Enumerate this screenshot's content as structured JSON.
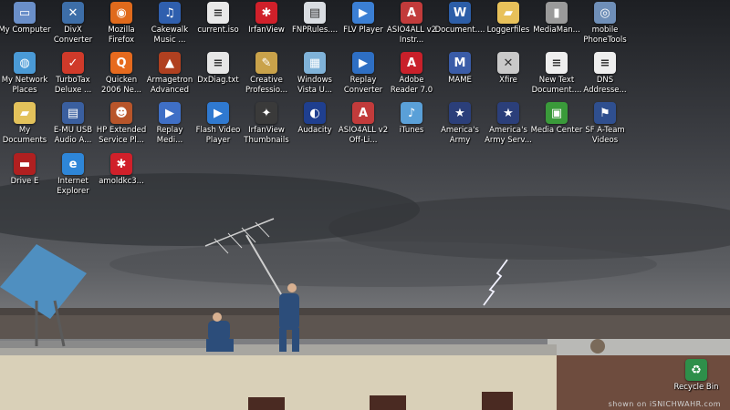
{
  "desktop": {
    "icons": [
      {
        "label": "My Computer",
        "glyph": "▭",
        "color": "#6a8fc9",
        "icon_name": "my-computer-icon"
      },
      {
        "label": "DivX Converter",
        "glyph": "✕",
        "color": "#3d6ea8",
        "icon_name": "divx-converter-icon"
      },
      {
        "label": "Mozilla Firefox",
        "glyph": "◉",
        "color": "#e06a1c",
        "icon_name": "firefox-icon"
      },
      {
        "label": "Cakewalk Music ...",
        "glyph": "♫",
        "color": "#2f5fae",
        "icon_name": "cakewalk-icon"
      },
      {
        "label": "current.iso",
        "glyph": "≡",
        "color": "#e8e8e8",
        "icon_name": "iso-file-icon"
      },
      {
        "label": "IrfanView",
        "glyph": "✱",
        "color": "#d0202a",
        "icon_name": "irfanview-icon"
      },
      {
        "label": "FNPRules....",
        "glyph": "▤",
        "color": "#d9dde2",
        "icon_name": "document-icon"
      },
      {
        "label": "FLV Player",
        "glyph": "▶",
        "color": "#3b7fd4",
        "icon_name": "flv-player-icon"
      },
      {
        "label": "ASIO4ALL v2 Instr...",
        "glyph": "A",
        "color": "#c23b3b",
        "icon_name": "asio4all-icon"
      },
      {
        "label": "Document....",
        "glyph": "W",
        "color": "#2c5ea8",
        "icon_name": "word-document-icon"
      },
      {
        "label": "Loggerfiles",
        "glyph": "▰",
        "color": "#e8c15a",
        "icon_name": "folder-icon"
      },
      {
        "label": "MediaMan...",
        "glyph": "▮",
        "color": "#9a9a9a",
        "icon_name": "media-manager-icon"
      },
      {
        "label": "mobile PhoneTools",
        "glyph": "◎",
        "color": "#6f8fb8",
        "icon_name": "phonetools-icon"
      },
      {
        "label": "My Network Places",
        "glyph": "◍",
        "color": "#4a9ad6",
        "icon_name": "network-places-icon"
      },
      {
        "label": "TurboTax Deluxe ...",
        "glyph": "✓",
        "color": "#d03a2a",
        "icon_name": "turbotax-icon"
      },
      {
        "label": "Quicken 2006 Ne...",
        "glyph": "Q",
        "color": "#e66a1e",
        "icon_name": "quicken-icon"
      },
      {
        "label": "Armagetron Advanced",
        "glyph": "▲",
        "color": "#b04020",
        "icon_name": "armagetron-icon"
      },
      {
        "label": "DxDiag.txt",
        "glyph": "≡",
        "color": "#e6e6e6",
        "icon_name": "text-file-icon"
      },
      {
        "label": "Creative Professio...",
        "glyph": "✎",
        "color": "#c9a24a",
        "icon_name": "creative-icon"
      },
      {
        "label": "Windows Vista U...",
        "glyph": "▦",
        "color": "#7fb2d8",
        "icon_name": "vista-upgrade-icon"
      },
      {
        "label": "Replay Converter",
        "glyph": "▶",
        "color": "#2e6fc4",
        "icon_name": "replay-converter-icon"
      },
      {
        "label": "Adobe Reader 7.0",
        "glyph": "A",
        "color": "#c9202a",
        "icon_name": "adobe-reader-icon"
      },
      {
        "label": "MAME",
        "glyph": "M",
        "color": "#3a5ca8",
        "icon_name": "mame-icon"
      },
      {
        "label": "Xfire",
        "glyph": "✕",
        "color": "#c9c9c9",
        "icon_name": "xfire-icon"
      },
      {
        "label": "New Text Document....",
        "glyph": "≡",
        "color": "#eeeeee",
        "icon_name": "text-document-icon"
      },
      {
        "label": "DNS Addresse...",
        "glyph": "≡",
        "color": "#eeeeee",
        "icon_name": "dns-document-icon"
      },
      {
        "label": "My Documents",
        "glyph": "▰",
        "color": "#e3c25b",
        "icon_name": "my-documents-icon"
      },
      {
        "label": "E-MU USB Audio A...",
        "glyph": "▤",
        "color": "#3a5f9f",
        "icon_name": "emu-audio-icon"
      },
      {
        "label": "HP Extended Service Pl...",
        "glyph": "☻",
        "color": "#b8552a",
        "icon_name": "hp-service-icon"
      },
      {
        "label": "Replay Medi...",
        "glyph": "▶",
        "color": "#3f6fc6",
        "icon_name": "replay-media-icon"
      },
      {
        "label": "Flash Video Player",
        "glyph": "▶",
        "color": "#2f79d0",
        "icon_name": "flash-video-icon"
      },
      {
        "label": "IrfanView Thumbnails",
        "glyph": "✦",
        "color": "#3a3a3a",
        "icon_name": "irfanview-thumbnails-icon"
      },
      {
        "label": "Audacity",
        "glyph": "◐",
        "color": "#1f3f8f",
        "icon_name": "audacity-icon"
      },
      {
        "label": "ASIO4ALL v2 Off-Li...",
        "glyph": "A",
        "color": "#c23b3b",
        "icon_name": "asio4all-offline-icon"
      },
      {
        "label": "iTunes",
        "glyph": "♪",
        "color": "#5aa0d8",
        "icon_name": "itunes-icon"
      },
      {
        "label": "America's Army",
        "glyph": "★",
        "color": "#2b3f7a",
        "icon_name": "americas-army-icon"
      },
      {
        "label": "America's Army Serv...",
        "glyph": "★",
        "color": "#2b3f7a",
        "icon_name": "americas-army-server-icon"
      },
      {
        "label": "Media Center",
        "glyph": "▣",
        "color": "#3a9a3a",
        "icon_name": "media-center-icon"
      },
      {
        "label": "SF A-Team Videos",
        "glyph": "⚑",
        "color": "#2f4f8f",
        "icon_name": "video-folder-icon"
      },
      {
        "label": "Drive E",
        "glyph": "▬",
        "color": "#b02020",
        "icon_name": "drive-icon"
      },
      {
        "label": "Internet Explorer",
        "glyph": "e",
        "color": "#2e86d8",
        "icon_name": "internet-explorer-icon"
      },
      {
        "label": "amoldkc3...",
        "glyph": "✱",
        "color": "#d0202a",
        "icon_name": "image-file-icon"
      }
    ],
    "recycle_bin": {
      "label": "Recycle Bin",
      "glyph": "♻",
      "color": "#2e8f4a",
      "icon_name": "recycle-bin-icon"
    },
    "watermark": "shown on iSNICHWAHR.com"
  }
}
